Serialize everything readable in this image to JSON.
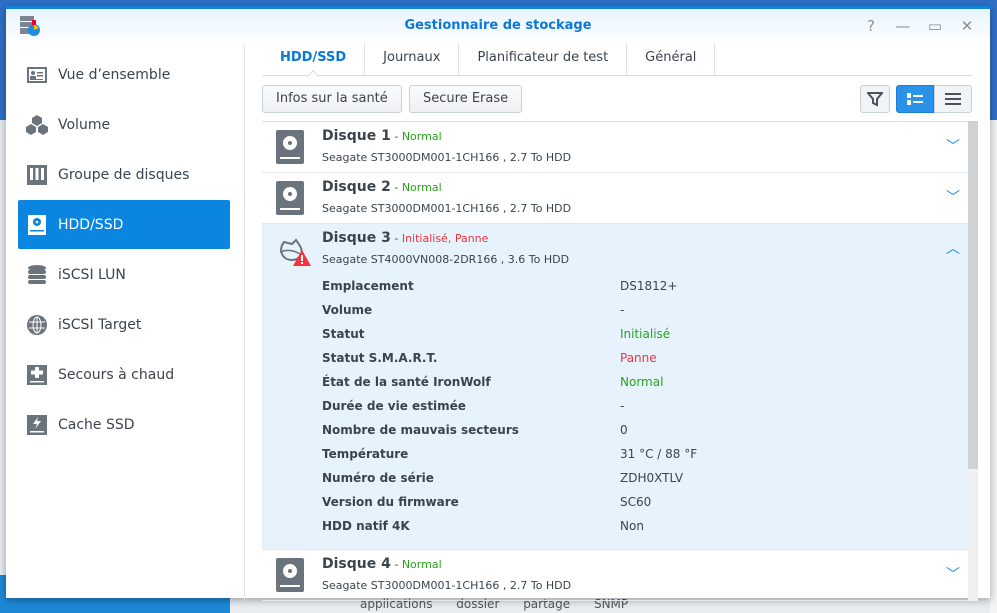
{
  "window": {
    "title": "Gestionnaire de stockage",
    "controls": [
      "?",
      "—",
      "▭",
      "✕"
    ]
  },
  "background_text": "applications dossier partage SNMP",
  "sidebar": {
    "items": [
      {
        "label": "Vue d’ensemble",
        "icon": "overview-icon"
      },
      {
        "label": "Volume",
        "icon": "cubes-icon"
      },
      {
        "label": "Groupe de disques",
        "icon": "disk-group-icon"
      },
      {
        "label": "HDD/SSD",
        "icon": "hdd-icon",
        "active": true
      },
      {
        "label": "iSCSI LUN",
        "icon": "database-icon"
      },
      {
        "label": "iSCSI Target",
        "icon": "globe-icon"
      },
      {
        "label": "Secours à chaud",
        "icon": "hot-spare-icon"
      },
      {
        "label": "Cache SSD",
        "icon": "ssd-cache-icon"
      }
    ]
  },
  "tabs": [
    {
      "label": "HDD/SSD",
      "active": true
    },
    {
      "label": "Journaux"
    },
    {
      "label": "Planificateur de test"
    },
    {
      "label": "Général"
    }
  ],
  "toolbar": {
    "health_info": "Infos sur la santé",
    "secure_erase": "Secure Erase"
  },
  "disks": [
    {
      "name": "Disque 1",
      "sep": " - ",
      "status": "Normal",
      "status_color": "#27a21b",
      "model": "Seagate ST3000DM001-1CH166 , 2.7 To HDD"
    },
    {
      "name": "Disque 2",
      "sep": " - ",
      "status": "Normal",
      "status_color": "#27a21b",
      "model": "Seagate ST3000DM001-1CH166 , 2.7 To HDD"
    },
    {
      "name": "Disque 3",
      "sep": " - ",
      "status": "Initialisé, Panne",
      "status_color": "#f0333d",
      "model": "Seagate ST4000VN008-2DR166 , 3.6 To HDD",
      "details": [
        {
          "label": "Emplacement",
          "value": "DS1812+"
        },
        {
          "label": "Volume",
          "value": "-"
        },
        {
          "label": "Statut",
          "value": "Initialisé",
          "color": "green"
        },
        {
          "label": "Statut S.M.A.R.T.",
          "value": "Panne",
          "color": "red"
        },
        {
          "label": "État de la santé IronWolf",
          "value": "Normal",
          "color": "green"
        },
        {
          "label": "Durée de vie estimée",
          "value": "-"
        },
        {
          "label": "Nombre de mauvais secteurs",
          "value": "0"
        },
        {
          "label": "Température",
          "value": "31 °C / 88 °F"
        },
        {
          "label": "Numéro de série",
          "value": "ZDH0XTLV"
        },
        {
          "label": "Version du firmware",
          "value": "SC60"
        },
        {
          "label": "HDD natif 4K",
          "value": "Non"
        }
      ]
    },
    {
      "name": "Disque 4",
      "sep": " - ",
      "status": "Normal",
      "status_color": "#27a21b",
      "model": "Seagate ST3000DM001-1CH166 , 2.7 To HDD"
    }
  ]
}
